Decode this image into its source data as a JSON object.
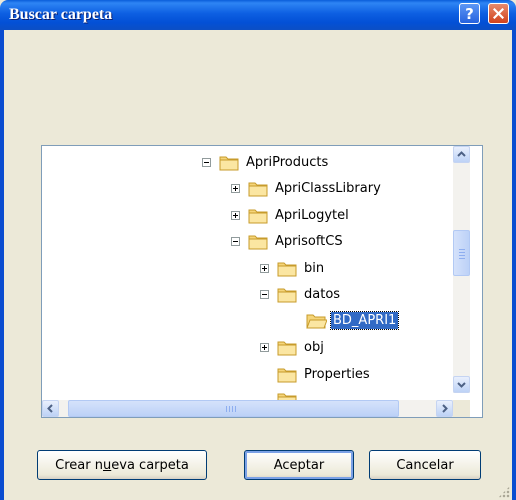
{
  "window": {
    "title": "Buscar carpeta"
  },
  "titlebar": {
    "help_glyph": "?",
    "close_glyph": "✕"
  },
  "tree": {
    "items": [
      {
        "label": "ApriProducts",
        "expander": "minus",
        "selected": false
      },
      {
        "label": "ApriClassLibrary",
        "expander": "plus",
        "selected": false
      },
      {
        "label": "ApriLogytel",
        "expander": "plus",
        "selected": false
      },
      {
        "label": "AprisoftCS",
        "expander": "minus",
        "selected": false
      },
      {
        "label": "bin",
        "expander": "plus",
        "selected": false
      },
      {
        "label": "datos",
        "expander": "minus",
        "selected": false
      },
      {
        "label": "BD_APRI1",
        "expander": "none",
        "selected": true
      },
      {
        "label": "obj",
        "expander": "plus",
        "selected": false
      },
      {
        "label": "Properties",
        "expander": "none",
        "selected": false
      }
    ]
  },
  "buttons": {
    "new_folder_pre": "Crear n",
    "new_folder_mnemonic": "u",
    "new_folder_post": "eva carpeta",
    "accept": "Aceptar",
    "cancel": "Cancelar"
  },
  "colors": {
    "title_bar": "#0350d6",
    "selection": "#316ac5",
    "dialog_bg": "#ece9d8"
  }
}
